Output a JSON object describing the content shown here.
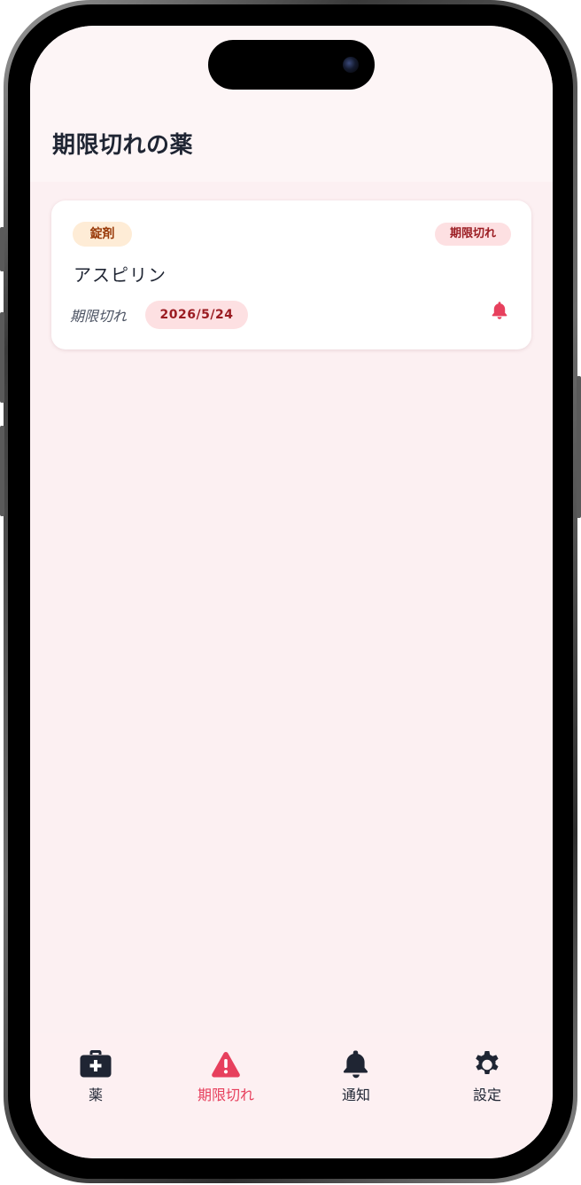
{
  "header": {
    "title": "期限切れの薬"
  },
  "medications": [
    {
      "form": "錠剤",
      "status": "期限切れ",
      "name": "アスピリン",
      "expiry_label": "期限切れ",
      "expiry_date": "2026/5/24"
    }
  ],
  "tabbar": {
    "tabs": [
      {
        "label": "薬",
        "icon": "medical-kit-icon",
        "active": false
      },
      {
        "label": "期限切れ",
        "icon": "warning-icon",
        "active": true
      },
      {
        "label": "通知",
        "icon": "bell-icon",
        "active": false
      },
      {
        "label": "設定",
        "icon": "gear-icon",
        "active": false
      }
    ]
  },
  "colors": {
    "accent": "#e7405d",
    "badge_expired_bg": "#fde0e2",
    "badge_expired_text": "#9b1c22",
    "badge_form_bg": "#feecd6",
    "badge_form_text": "#9a3c0c",
    "background": "#fcf0f2",
    "text_primary": "#1f2533"
  }
}
